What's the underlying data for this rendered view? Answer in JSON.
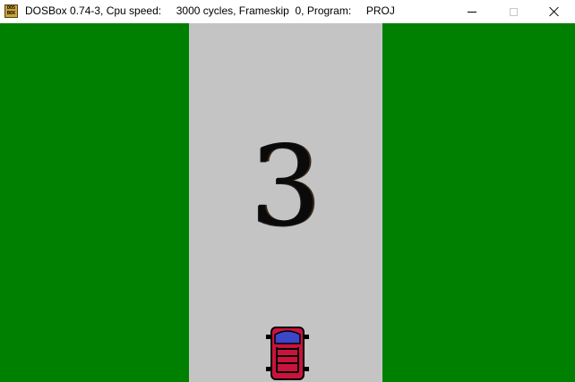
{
  "window": {
    "title": "DOSBox 0.74-3, Cpu speed:     3000 cycles, Frameskip  0, Program:     PROJ",
    "app_icon_text": "DOS BOX",
    "controls": [
      "minimize-icon",
      "maximize-icon",
      "close-icon"
    ]
  },
  "game": {
    "countdown": "3",
    "colors": {
      "grass": "#008000",
      "road": "#c4c4c4",
      "car_body": "#c8143c",
      "car_roof": "#3c46c8",
      "car_wheels": "#000000"
    },
    "player_car_icon": "red-car-icon"
  }
}
